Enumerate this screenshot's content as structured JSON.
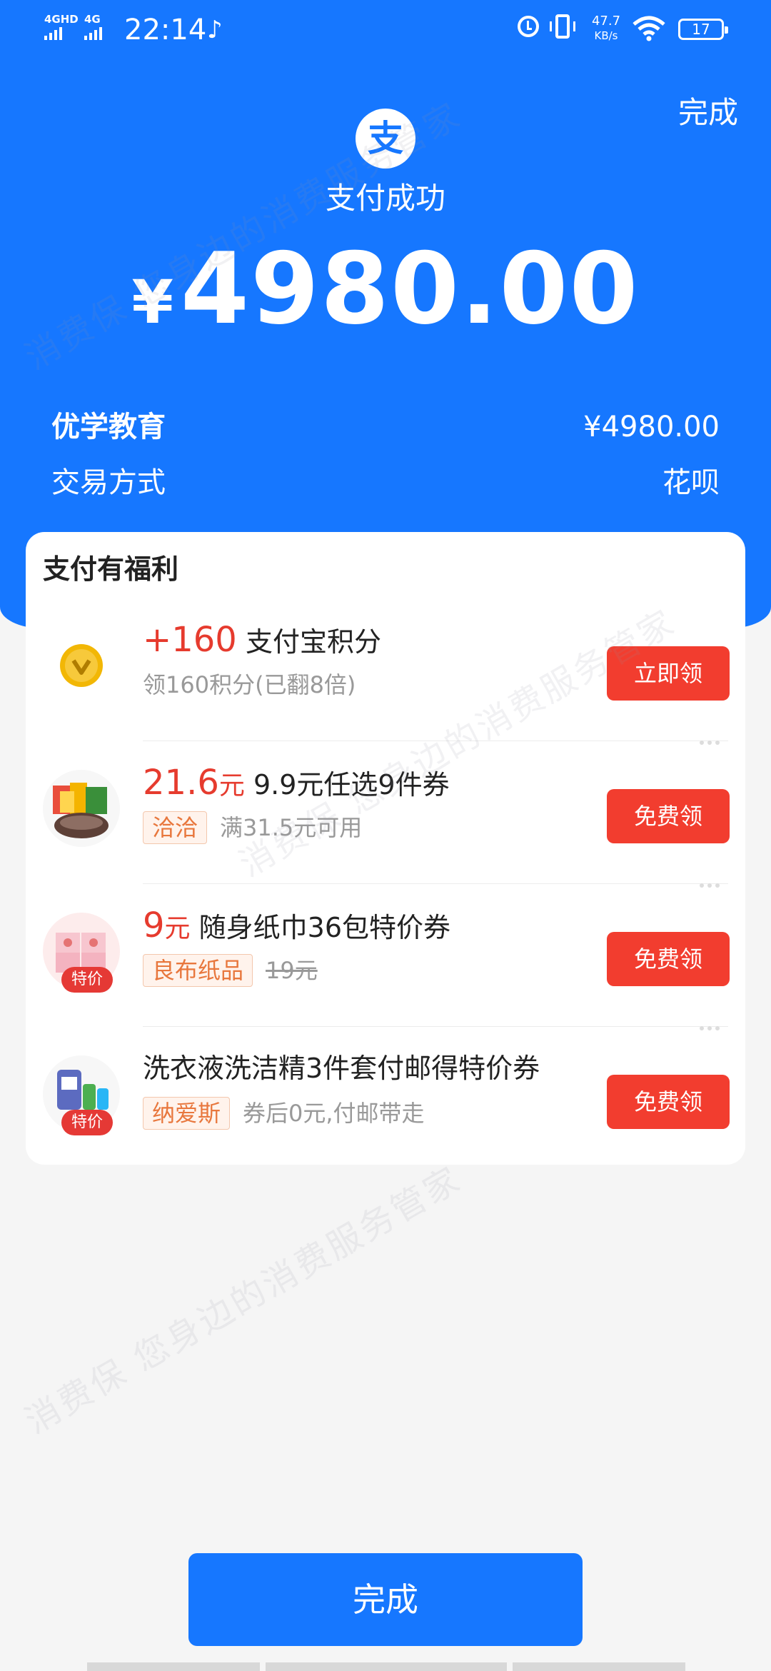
{
  "status_bar": {
    "signal_1": "4GHD",
    "signal_2": "4G",
    "time": "22:14",
    "net_speed": "47.7",
    "net_speed_unit": "KB/s",
    "battery": "17"
  },
  "header": {
    "done_label": "完成",
    "title": "支付成功",
    "currency_symbol": "¥",
    "amount": "4980.00"
  },
  "details": [
    {
      "label": "优学教育",
      "value": "¥4980.00"
    },
    {
      "label": "交易方式",
      "value": "花呗"
    }
  ],
  "benefits": {
    "title": "支付有福利",
    "items": [
      {
        "highlight": "+160",
        "unit": "",
        "title": "支付宝积分",
        "brand": "",
        "desc": "领160积分(已翻8倍)",
        "button": "立即领"
      },
      {
        "highlight": "21.6",
        "unit": "元",
        "title": "9.9元任选9件券",
        "brand": "洽洽",
        "desc": "满31.5元可用",
        "button": "免费领"
      },
      {
        "highlight": "9",
        "unit": "元",
        "title": "随身纸巾36包特价券",
        "brand": "良布纸品",
        "desc": "19元",
        "button": "免费领",
        "badge": "特价"
      },
      {
        "highlight": "",
        "unit": "",
        "title": "洗衣液洗洁精3件套付邮得特价券",
        "brand": "纳爱斯",
        "desc": "券后0元,付邮带走",
        "button": "免费领",
        "badge": "特价"
      }
    ]
  },
  "footer": {
    "done_label": "完成"
  },
  "watermark": "消费保 您身边的消费服务管家",
  "colors": {
    "primary": "#1677ff",
    "accent": "#f23d2f",
    "highlight": "#e63b2e"
  }
}
